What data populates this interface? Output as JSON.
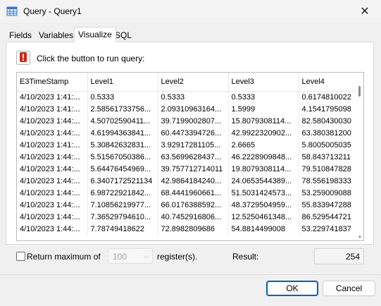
{
  "window": {
    "title": "Query - Query1"
  },
  "tabs": [
    {
      "label": "Fields"
    },
    {
      "label": "Variables"
    },
    {
      "label": "Visualize",
      "active": true
    },
    {
      "label": "SQL"
    }
  ],
  "run": {
    "label": "Click the button to run query:",
    "icon": "exclamation-icon",
    "icon_color": "#c42b1c"
  },
  "grid": {
    "columns": [
      "E3TimeStamp",
      "Level1",
      "Level2",
      "Level3",
      "Level4"
    ],
    "rows": [
      [
        "4/10/2023 1:41:...",
        "0.5333",
        "0.5333",
        "0.5333",
        "0.6174810022"
      ],
      [
        "4/10/2023 1:41:...",
        "2.58561733756...",
        "2.09310963164...",
        "1.5999",
        "4.1541795098"
      ],
      [
        "4/10/2023 1:44:...",
        "4.50702590411...",
        "39.7199002807...",
        "15.8079308114...",
        "82.580430030"
      ],
      [
        "4/10/2023 1:44:...",
        "4.61994363841...",
        "60.4473394726...",
        "42.9922320902...",
        "63.380381200"
      ],
      [
        "4/10/2023 1:41:...",
        "5.30842632831...",
        "3.92917281105...",
        "2.6665",
        "5.8005005035"
      ],
      [
        "4/10/2023 1:44:...",
        "5.51567050386...",
        "63.5699628437...",
        "46.2228909848...",
        "58.843713211"
      ],
      [
        "4/10/2023 1:44:...",
        "5.64476454969...",
        "39.757712714011",
        "19.8079308114...",
        "79.510847828"
      ],
      [
        "4/10/2023 1:44:...",
        "6.3407172521134",
        "42.9864184240...",
        "24.0653544389...",
        "78.556198333"
      ],
      [
        "4/10/2023 1:44:...",
        "6.98722921842...",
        "68.4441960661...",
        "51.5031424573...",
        "53.259009088"
      ],
      [
        "4/10/2023 1:44:...",
        "7.10856219977...",
        "66.0176388592...",
        "48.3729504959...",
        "55.833947288"
      ],
      [
        "4/10/2023 1:44:...",
        "7.36529794610...",
        "40.7452916806...",
        "12.5250461348...",
        "86.529544721"
      ],
      [
        "4/10/2023 1:44:...",
        "7.78749418622",
        "72.8982809686",
        "54.8814499008",
        "53.229741837"
      ]
    ]
  },
  "options": {
    "return_max_label": "Return maximum of",
    "return_max_checked": false,
    "max_value": "100",
    "registers_label": "register(s).",
    "result_label": "Result:",
    "result_value": "254"
  },
  "buttons": {
    "ok": "OK",
    "cancel": "Cancel"
  },
  "colors": {
    "ok_border": "#005fb8",
    "accent": "#005fb8"
  }
}
